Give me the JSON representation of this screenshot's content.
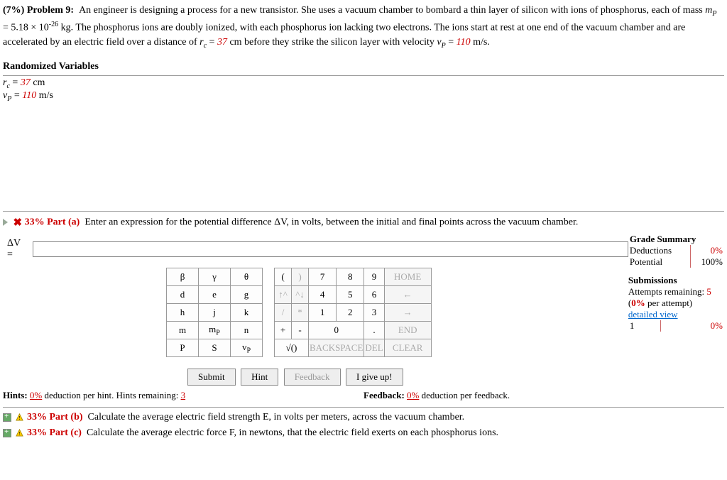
{
  "problem": {
    "weight": "(7%)",
    "label": "Problem 9:",
    "text1": "An engineer is designing a process for a new transistor. She uses a vacuum chamber to bombard a thin layer of silicon with ions of phosphorus, each of mass ",
    "mp_eq": "m",
    "mp_sub": "P",
    "mp_val": " = 5.18 × 10",
    "mp_exp": "-26",
    "text2": " kg. The phosphorus ions are doubly ionized, with each phosphorus ion lacking two electrons. The ions start at rest at one end of the vacuum chamber and are accelerated by an electric field over a distance of ",
    "rc_eq": "r",
    "rc_sub": "c",
    "rc_val": "37",
    "text3": " cm before they strike the silicon layer with velocity ",
    "vp_eq": "v",
    "vp_sub": "P",
    "vp_val": "110",
    "text4": " m/s."
  },
  "rv": {
    "header": "Randomized Variables",
    "l1a": "r",
    "l1b": "c",
    "l1v": "37",
    "l1u": " cm",
    "l2a": "v",
    "l2b": "P",
    "l2v": "110",
    "l2u": " m/s"
  },
  "part_a": {
    "pct": "33%",
    "label": "Part (a)",
    "text": "Enter an expression for the potential difference ΔV, in volts, between the initial and final points across the vacuum chamber.",
    "answer_label": "ΔV = "
  },
  "vars": [
    [
      "β",
      "γ",
      "θ"
    ],
    [
      "d",
      "e",
      "g"
    ],
    [
      "h",
      "j",
      "k"
    ],
    [
      "m",
      "mP",
      "n"
    ],
    [
      "P",
      "S",
      "vP"
    ]
  ],
  "nums": [
    [
      {
        "t": "(",
        "h": 1
      },
      {
        "t": ")",
        "h": 1,
        "d": 1
      },
      {
        "t": "7",
        "h": 1
      },
      {
        "t": "8",
        "h": 1
      },
      {
        "t": "9",
        "h": 1
      },
      {
        "t": "HOME",
        "w": 1,
        "d": 1
      }
    ],
    [
      {
        "t": "↑^",
        "h": 1,
        "d": 1
      },
      {
        "t": "^↓",
        "h": 1,
        "d": 1
      },
      {
        "t": "4",
        "h": 1
      },
      {
        "t": "5",
        "h": 1
      },
      {
        "t": "6",
        "h": 1
      },
      {
        "t": "←",
        "w": 1,
        "d": 1
      }
    ],
    [
      {
        "t": "/",
        "h": 1,
        "d": 1
      },
      {
        "t": "*",
        "h": 1,
        "d": 1
      },
      {
        "t": "1",
        "h": 1
      },
      {
        "t": "2",
        "h": 1
      },
      {
        "t": "3",
        "h": 1
      },
      {
        "t": "→",
        "w": 1,
        "d": 1
      }
    ],
    [
      {
        "t": "+",
        "h": 1
      },
      {
        "t": "-",
        "h": 1
      },
      {
        "t": "0",
        "c": 2
      },
      {
        "t": ".",
        "h": 1
      },
      {
        "t": "END",
        "w": 1,
        "d": 1
      }
    ],
    [
      {
        "t": "√()",
        "h": 1,
        "c": 2
      },
      {
        "t": "BACKSPACE",
        "c": 2,
        "d": 1
      },
      {
        "t": "DEL",
        "h": 1,
        "d": 1
      },
      {
        "t": "CLEAR",
        "w": 1,
        "d": 1
      }
    ]
  ],
  "grade": {
    "hdr": "Grade Summary",
    "ded": "Deductions",
    "ded_v": "0%",
    "pot": "Potential",
    "pot_v": "100%",
    "sub": "Submissions",
    "att": "Attempts remaining: ",
    "att_v": "5",
    "per": "(",
    "per_v": "0%",
    "per2": " per attempt)",
    "dv": "detailed view",
    "r1": "1",
    "r1v": "0%"
  },
  "buttons": {
    "submit": "Submit",
    "hint": "Hint",
    "feedback": "Feedback",
    "giveup": "I give up!"
  },
  "hints": {
    "l1": "Hints: ",
    "l1v": "0%",
    "l2": " deduction per hint. Hints remaining: ",
    "l2v": "3",
    "r1": "Feedback: ",
    "r1v": "0%",
    "r2": " deduction per feedback."
  },
  "part_b": {
    "pct": "33%",
    "label": "Part (b)",
    "text": "Calculate the average electric field strength E, in volts per meters, across the vacuum chamber."
  },
  "part_c": {
    "pct": "33%",
    "label": "Part (c)",
    "text": "Calculate the average electric force F, in newtons, that the electric field exerts on each phosphorus ions."
  }
}
